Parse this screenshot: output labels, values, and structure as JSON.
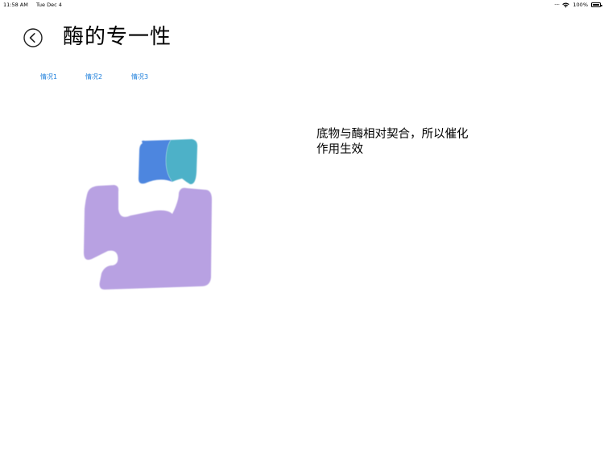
{
  "status_bar": {
    "time": "11:58 AM",
    "date": "Tue Dec 4",
    "battery": "100%",
    "battery_level": 1.0
  },
  "header": {
    "title": "酶的专一性",
    "back_icon": "chevron-left-circle-icon"
  },
  "tabs": [
    {
      "label": "情况1"
    },
    {
      "label": "情况2"
    },
    {
      "label": "情况3"
    }
  ],
  "illustration": {
    "enzyme_color": "#b8a1e2",
    "substrate_left_color": "#4d86df",
    "substrate_right_color": "#4db1c8"
  },
  "description": {
    "line1": "底物与酶相对契合，所以催化",
    "line2": "作用生效"
  }
}
